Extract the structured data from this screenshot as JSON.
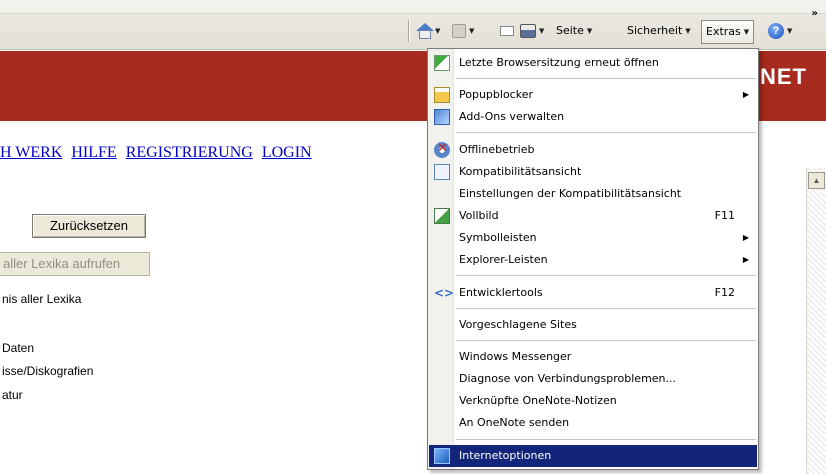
{
  "toolbar": {
    "page_label": "Seite",
    "security_label": "Sicherheit",
    "extras_label": "Extras",
    "overflow": "»"
  },
  "banner": {
    "logo_fragment": "NET"
  },
  "page": {
    "nav_links": [
      "H WERK",
      "HILFE",
      "REGISTRIERUNG",
      "LOGIN"
    ],
    "reset_button": "Zurücksetzen",
    "lexika_button": "aller Lexika aufrufen",
    "text_lines": [
      "nis aller Lexika",
      "Daten",
      "isse/Diskografien",
      "atur"
    ]
  },
  "menu": {
    "items": [
      {
        "label": "Letzte Browsersitzung erneut öffnen",
        "icon": "history-icon"
      },
      {
        "label": "Popupblocker",
        "icon": "popup-blocker-icon",
        "submenu": true
      },
      {
        "label": "Add-Ons verwalten",
        "icon": "addons-icon"
      },
      {
        "label": "Offlinebetrieb",
        "icon": "offline-icon"
      },
      {
        "label": "Kompatibilitätsansicht",
        "icon": "compatibility-icon"
      },
      {
        "label": "Einstellungen der Kompatibilitätsansicht"
      },
      {
        "label": "Vollbild",
        "icon": "fullscreen-icon",
        "shortcut": "F11"
      },
      {
        "label": "Symbolleisten",
        "submenu": true
      },
      {
        "label": "Explorer-Leisten",
        "submenu": true
      },
      {
        "label": "Entwicklertools",
        "icon": "developer-tools-icon",
        "shortcut": "F12"
      },
      {
        "label": "Vorgeschlagene Sites"
      },
      {
        "label": "Windows Messenger"
      },
      {
        "label": "Diagnose von Verbindungsproblemen..."
      },
      {
        "label": "Verknüpfte OneNote-Notizen"
      },
      {
        "label": "An OneNote senden"
      },
      {
        "label": "Internetoptionen",
        "icon": "internet-options-icon",
        "highlighted": true
      }
    ]
  },
  "colors": {
    "banner": "#a62a1e",
    "menu_highlight": "#12257a",
    "link": "#0000cc"
  }
}
